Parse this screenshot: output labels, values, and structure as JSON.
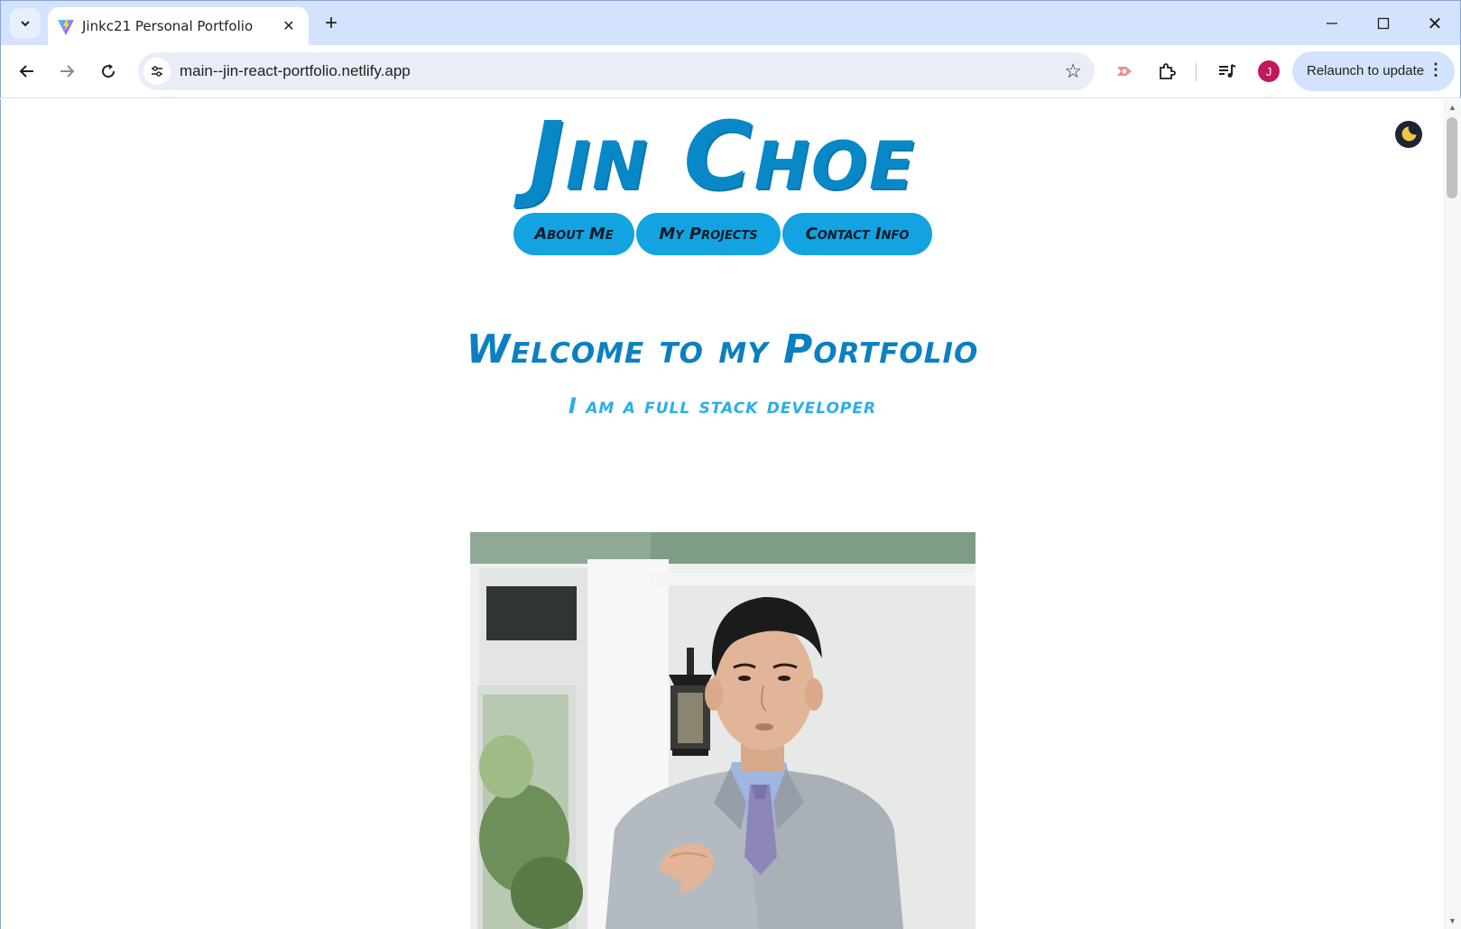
{
  "browser": {
    "tab_title": "Jinkc21 Personal Portfolio",
    "url": "main--jin-react-portfolio.netlify.app",
    "relaunch_label": "Relaunch to update",
    "profile_initial": "J"
  },
  "page": {
    "site_title": "Jin Choe",
    "nav": [
      "About Me",
      "My Projects",
      "Contact Info"
    ],
    "welcome_heading": "Welcome to my Portfolio",
    "tagline": "I am a full stack developer"
  },
  "colors": {
    "title_blue": "#0888c7",
    "pill_blue": "#12a3e0",
    "tagline_blue": "#29aee8"
  },
  "icons": {
    "theme_toggle": "moon-icon"
  }
}
